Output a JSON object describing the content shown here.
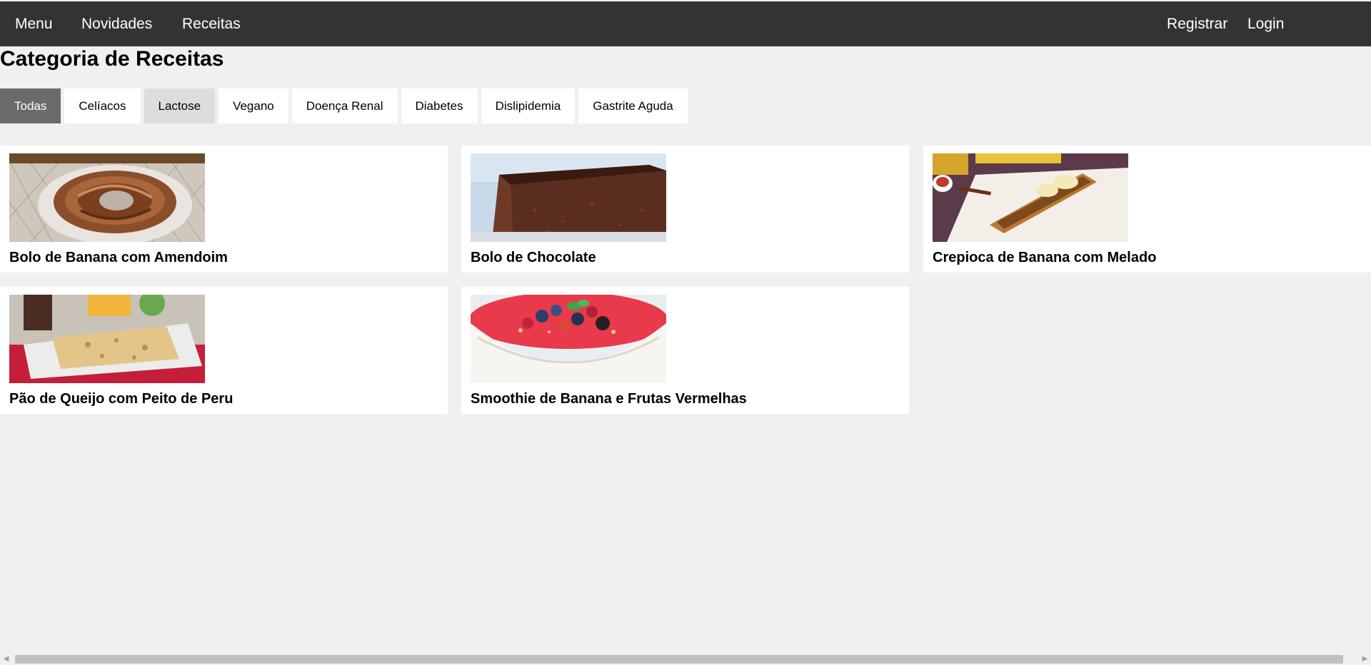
{
  "nav": {
    "left": [
      "Menu",
      "Novidades",
      "Receitas"
    ],
    "right": [
      "Registrar",
      "Login"
    ]
  },
  "page": {
    "title": "Categoria de Receitas"
  },
  "categories": {
    "items": [
      "Todas",
      "Celíacos",
      "Lactose",
      "Vegano",
      "Doença Renal",
      "Diabetes",
      "Dislipidemia",
      "Gastrite Aguda"
    ],
    "selected": "Todas",
    "hovered": "Lactose"
  },
  "recipes": [
    {
      "title": "Bolo de Banana com Amendoim",
      "image": "banana-cake-image"
    },
    {
      "title": "Bolo de Chocolate",
      "image": "chocolate-cake-image"
    },
    {
      "title": "Crepioca de Banana com Melado",
      "image": "crepioca-image"
    },
    {
      "title": "Pão de Queijo com Peito de Peru",
      "image": "cheese-bread-image"
    },
    {
      "title": "Smoothie de Banana e Frutas Vermelhas",
      "image": "smoothie-image"
    }
  ],
  "colors": {
    "topbar": "#333333",
    "background": "#f0f0f0",
    "tab_selected": "#6b6b6b",
    "tab_hover": "#dddddd",
    "card": "#ffffff"
  },
  "icons": {
    "scroll_left": "scroll-left-arrow-icon",
    "scroll_right": "scroll-right-arrow-icon"
  }
}
